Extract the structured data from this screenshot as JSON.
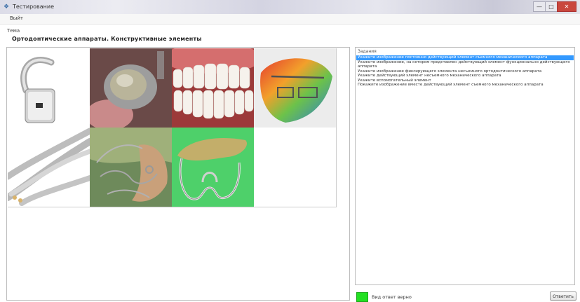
{
  "window": {
    "title": "Тестирование",
    "controls": {
      "minimize": "—",
      "maximize": "□",
      "close": "✕"
    }
  },
  "menu": {
    "file": "Выйт"
  },
  "topic": {
    "label": "Тема",
    "value": "Ортодонтические аппараты. Конструктивные элементы"
  },
  "images": [
    {
      "name": "buccal-tube",
      "selected": false
    },
    {
      "name": "metal-crown",
      "selected": false
    },
    {
      "name": "teeth-row",
      "selected": false
    },
    {
      "name": "colored-appliance",
      "selected": false
    },
    {
      "name": "twisted-wire",
      "selected": false
    },
    {
      "name": "plate-with-clasps",
      "selected": false
    },
    {
      "name": "wire-loop-on-green",
      "selected": true
    }
  ],
  "tasks": {
    "label": "Задания",
    "items": [
      "Укажите изображение постоянно действующий элемент съемного механического аппарата",
      "Укажите изображение, на котором представлен действующий элемент функционально действующего аппарата",
      "Укажите изображение фиксирующего элемента несъемного ортодонтического аппарата",
      "Укажите действующий элемент несъемного механического аппарата",
      "Укажите вспомогательный элемент",
      "Покажите изображение вместе действующий элемент съемного механического аппарата"
    ],
    "selected_index": 0
  },
  "answer": {
    "color": "#22e022",
    "text": "Вид  ответ  верно"
  },
  "next_button": {
    "label": "Ответить"
  }
}
